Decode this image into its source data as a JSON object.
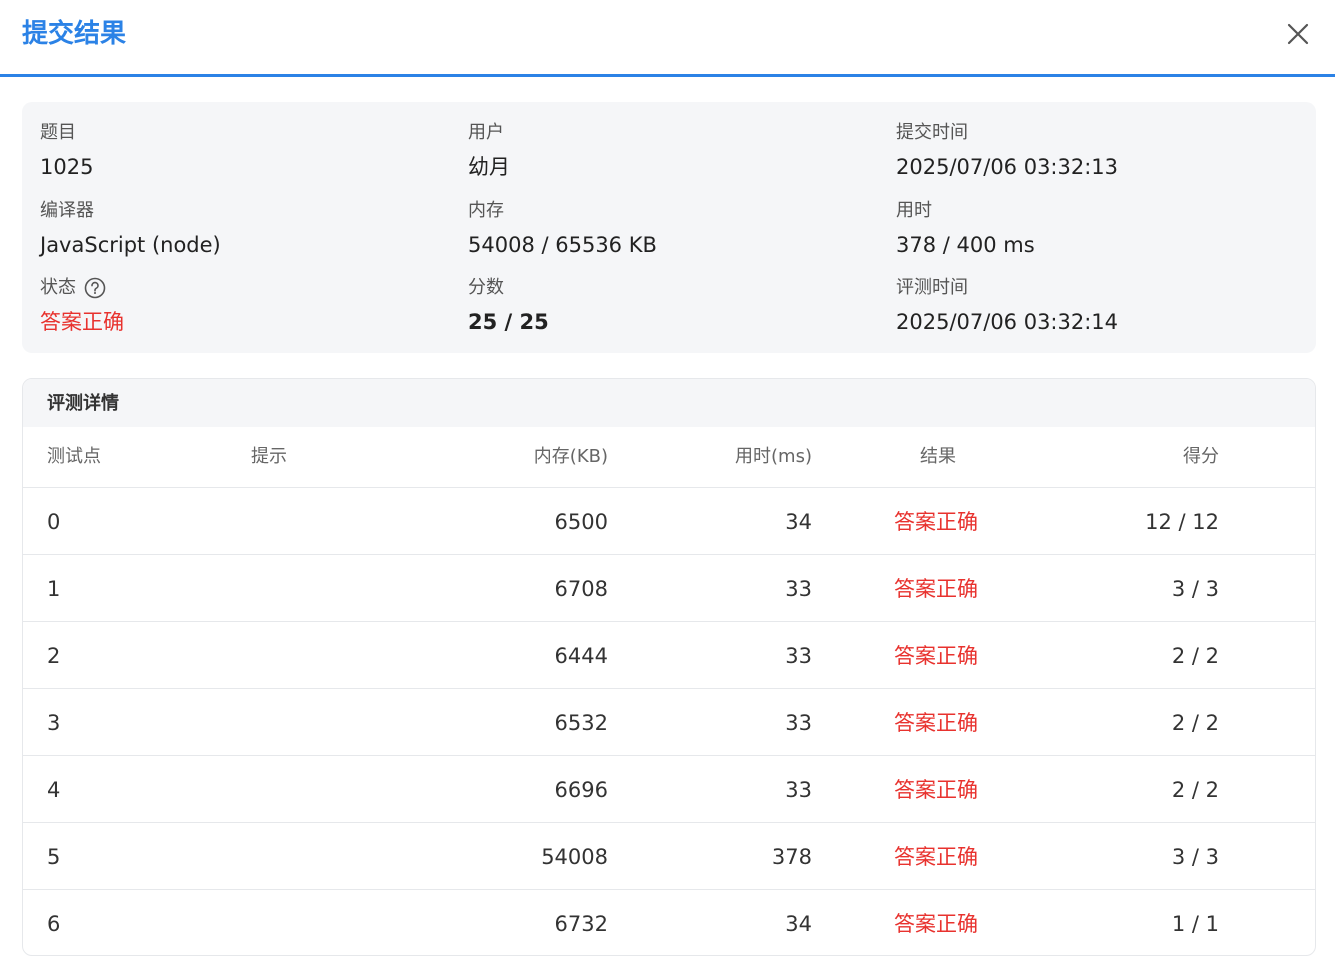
{
  "dialog": {
    "title": "提交结果"
  },
  "info": {
    "problem_label": "题目",
    "problem_value": "1025",
    "user_label": "用户",
    "user_value": "幼月",
    "submit_time_label": "提交时间",
    "submit_time_value": "2025/07/06 03:32:13",
    "compiler_label": "编译器",
    "compiler_value": "JavaScript (node)",
    "memory_label": "内存",
    "memory_value": "54008 / 65536 KB",
    "time_label": "用时",
    "time_value": "378 / 400 ms",
    "status_label": "状态",
    "status_value": "答案正确",
    "score_label": "分数",
    "score_value": "25 / 25",
    "judge_time_label": "评测时间",
    "judge_time_value": "2025/07/06 03:32:14"
  },
  "details": {
    "title": "评测详情",
    "columns": {
      "case": "测试点",
      "hint": "提示",
      "memory": "内存(KB)",
      "time": "用时(ms)",
      "result": "结果",
      "score": "得分"
    },
    "rows": [
      {
        "case": "0",
        "hint": "",
        "memory": "6500",
        "time": "34",
        "result": "答案正确",
        "score": "12 / 12"
      },
      {
        "case": "1",
        "hint": "",
        "memory": "6708",
        "time": "33",
        "result": "答案正确",
        "score": "3 / 3"
      },
      {
        "case": "2",
        "hint": "",
        "memory": "6444",
        "time": "33",
        "result": "答案正确",
        "score": "2 / 2"
      },
      {
        "case": "3",
        "hint": "",
        "memory": "6532",
        "time": "33",
        "result": "答案正确",
        "score": "2 / 2"
      },
      {
        "case": "4",
        "hint": "",
        "memory": "6696",
        "time": "33",
        "result": "答案正确",
        "score": "2 / 2"
      },
      {
        "case": "5",
        "hint": "",
        "memory": "54008",
        "time": "378",
        "result": "答案正确",
        "score": "3 / 3"
      },
      {
        "case": "6",
        "hint": "",
        "memory": "6732",
        "time": "34",
        "result": "答案正确",
        "score": "1 / 1"
      }
    ]
  },
  "colors": {
    "accent": "#2b82e6",
    "success_text": "#e8322e",
    "panel_bg": "#f5f6f8"
  }
}
